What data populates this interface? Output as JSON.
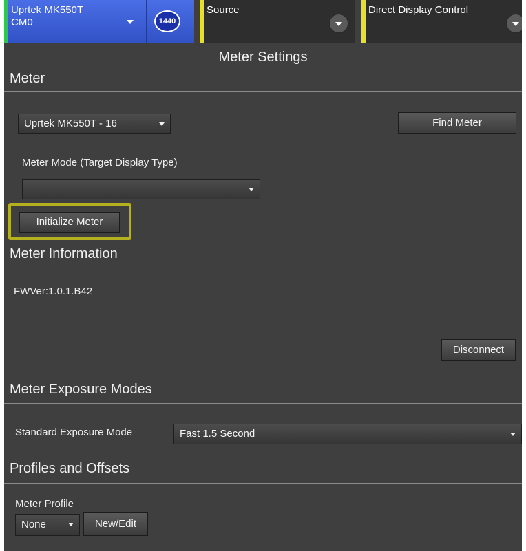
{
  "tabs": {
    "meter": {
      "title_line1": "Uprtek MK550T",
      "title_line2": "CM0",
      "badge": "1440",
      "color": "#3d5fd6",
      "stripe": "#2fc74a"
    },
    "source": {
      "title": "Source",
      "stripe": "#e6e02a"
    },
    "direct_display": {
      "title": "Direct Display Control",
      "stripe": "#e6e02a"
    }
  },
  "panel_title": "Meter Settings",
  "meter": {
    "heading": "Meter",
    "selected_meter": "Uprtek MK550T - 16",
    "find_meter_label": "Find Meter",
    "mode_label": "Meter Mode (Target Display Type)",
    "mode_value": "",
    "initialize_label": "Initialize Meter"
  },
  "meter_information": {
    "heading": "Meter Information",
    "fw_version": "FWVer:1.0.1.B42",
    "disconnect_label": "Disconnect"
  },
  "exposure": {
    "heading": "Meter Exposure Modes",
    "standard_label": "Standard Exposure Mode",
    "standard_value": "Fast 1.5 Second"
  },
  "profiles": {
    "heading": "Profiles and Offsets",
    "meter_profile_label": "Meter Profile",
    "profile_value": "None",
    "new_edit_label": "New/Edit"
  },
  "colors": {
    "background": "#3f3f3f",
    "highlight": "#b5b01e"
  }
}
